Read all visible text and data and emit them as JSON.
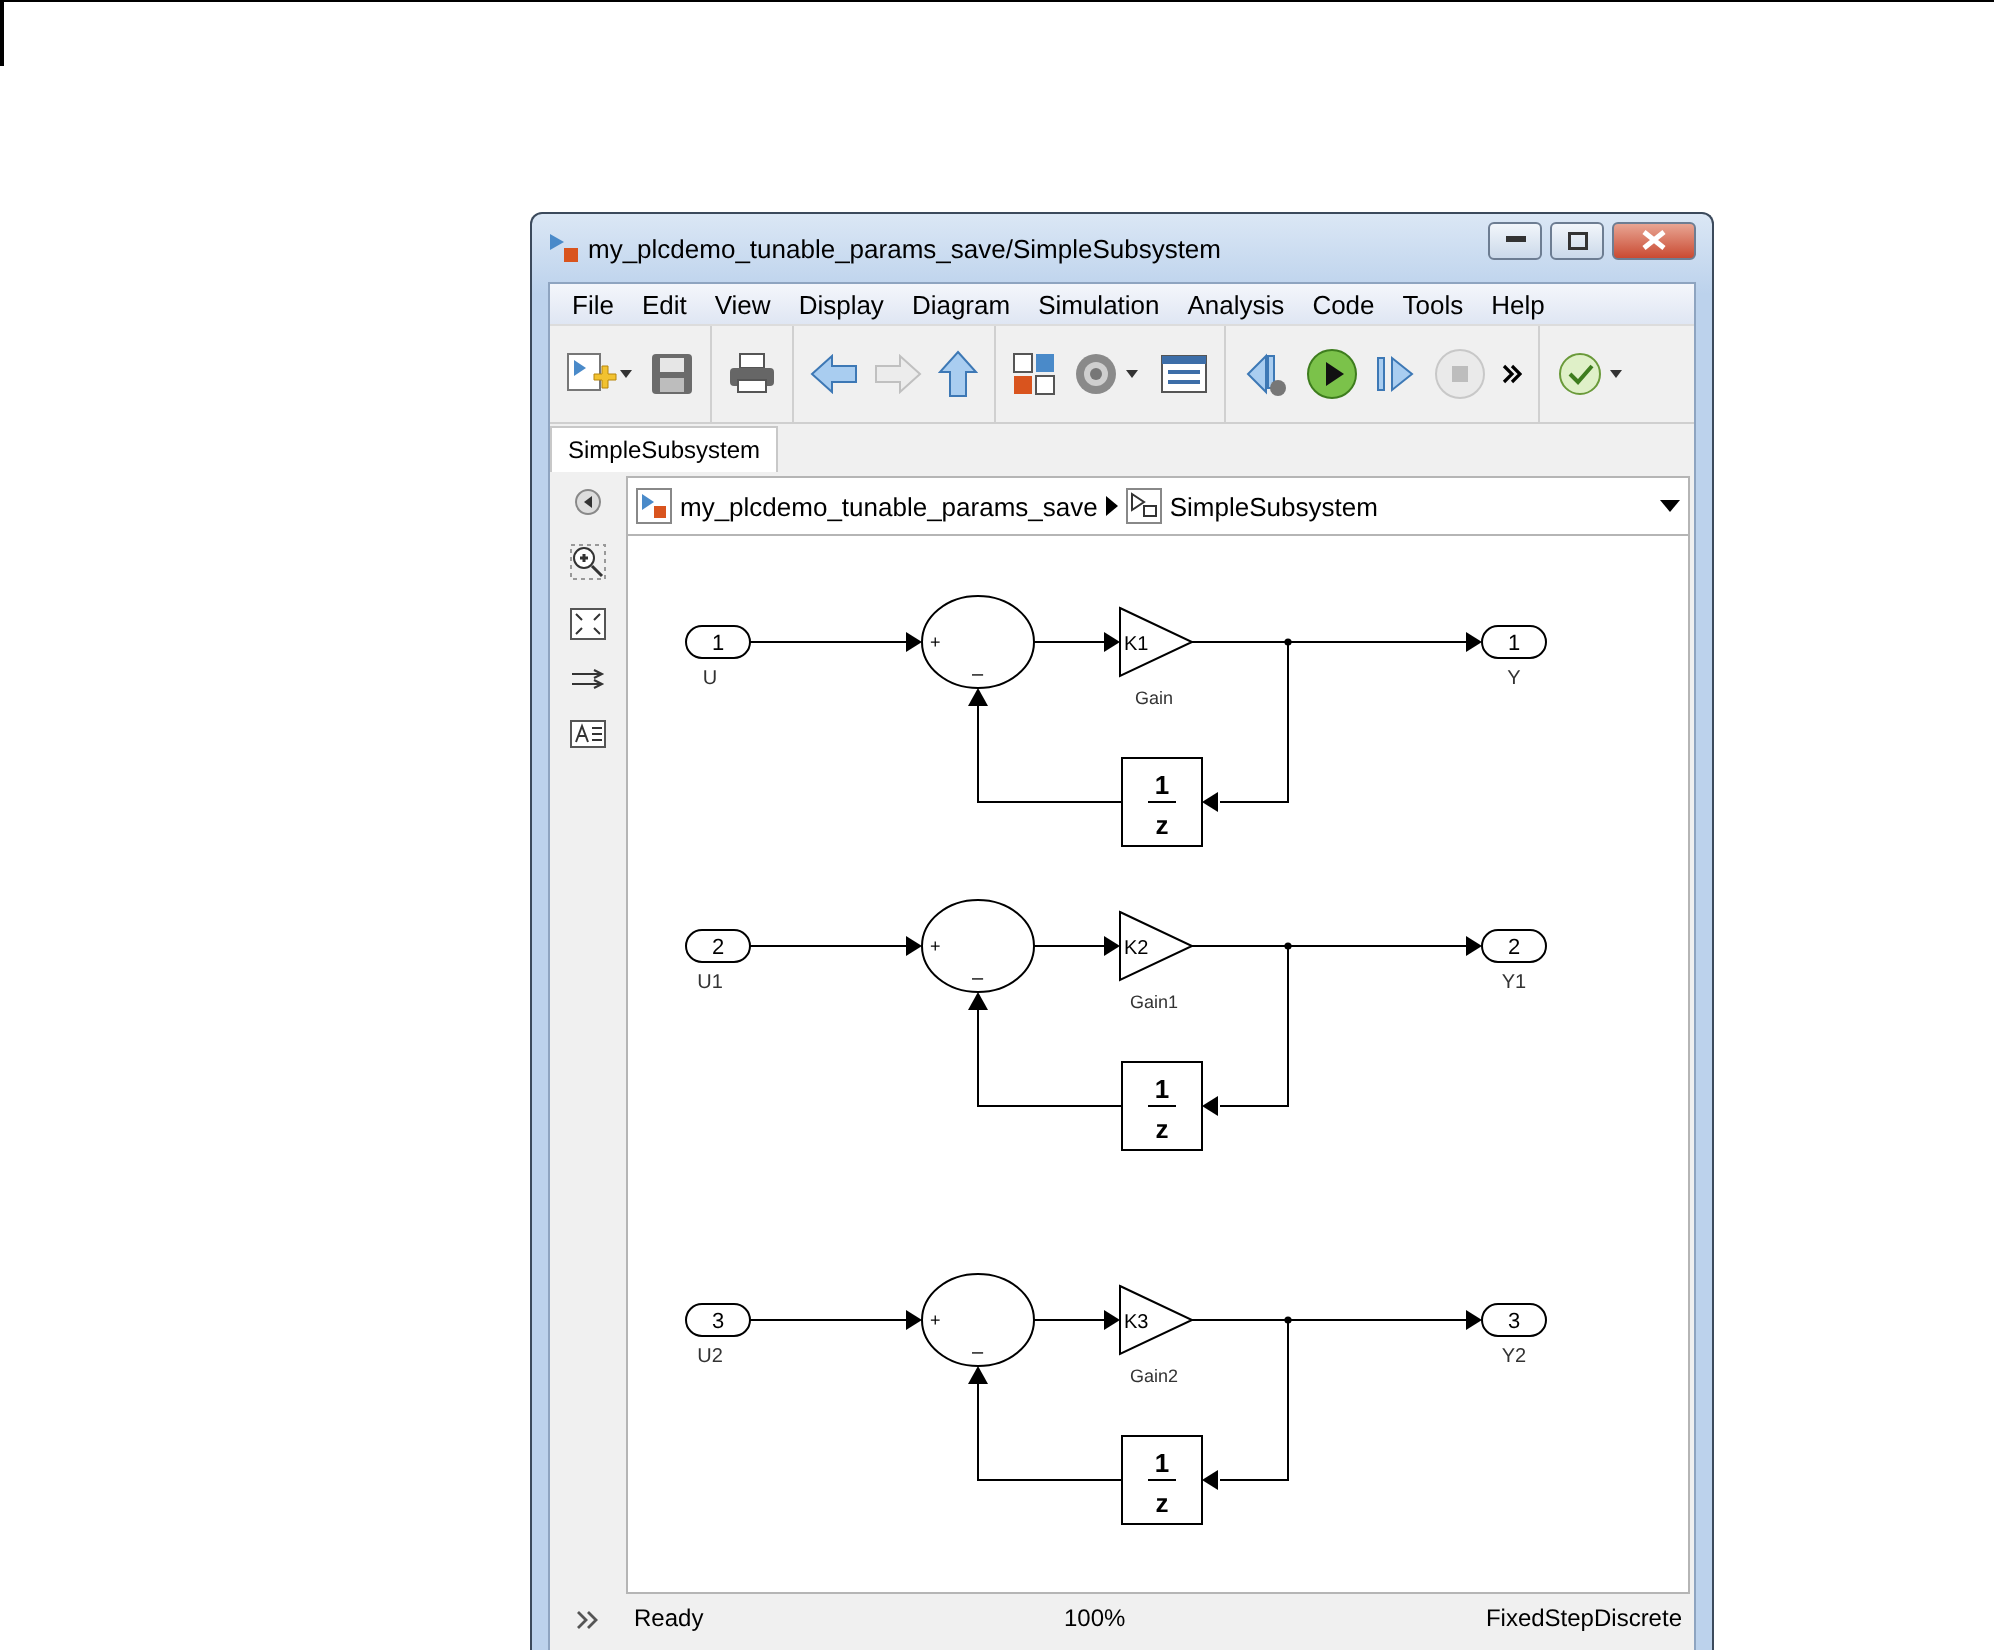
{
  "window": {
    "title": "my_plcdemo_tunable_params_save/SimpleSubsystem"
  },
  "menu": [
    "File",
    "Edit",
    "View",
    "Display",
    "Diagram",
    "Simulation",
    "Analysis",
    "Code",
    "Tools",
    "Help"
  ],
  "tabs": [
    {
      "label": "SimpleSubsystem",
      "selected": true
    }
  ],
  "breadcrumb": [
    {
      "label": "my_plcdemo_tunable_params_save",
      "kind": "model"
    },
    {
      "label": "SimpleSubsystem",
      "kind": "subsystem"
    }
  ],
  "diagram": {
    "rows": [
      {
        "inport": {
          "number": "1",
          "name": "U"
        },
        "sum_signs": [
          "+",
          "–"
        ],
        "gain": {
          "param": "K1",
          "name": "Gain"
        },
        "delay": {
          "numerator": "1",
          "denominator": "z"
        },
        "outport": {
          "number": "1",
          "name": "Y"
        }
      },
      {
        "inport": {
          "number": "2",
          "name": "U1"
        },
        "sum_signs": [
          "+",
          "–"
        ],
        "gain": {
          "param": "K2",
          "name": "Gain1"
        },
        "delay": {
          "numerator": "1",
          "denominator": "z"
        },
        "outport": {
          "number": "2",
          "name": "Y1"
        }
      },
      {
        "inport": {
          "number": "3",
          "name": "U2"
        },
        "sum_signs": [
          "+",
          "–"
        ],
        "gain": {
          "param": "K3",
          "name": "Gain2"
        },
        "delay": {
          "numerator": "1",
          "denominator": "z"
        },
        "outport": {
          "number": "3",
          "name": "Y2"
        }
      }
    ]
  },
  "status_bar": {
    "state": "Ready",
    "zoom": "100%",
    "solver": "FixedStepDiscrete"
  }
}
